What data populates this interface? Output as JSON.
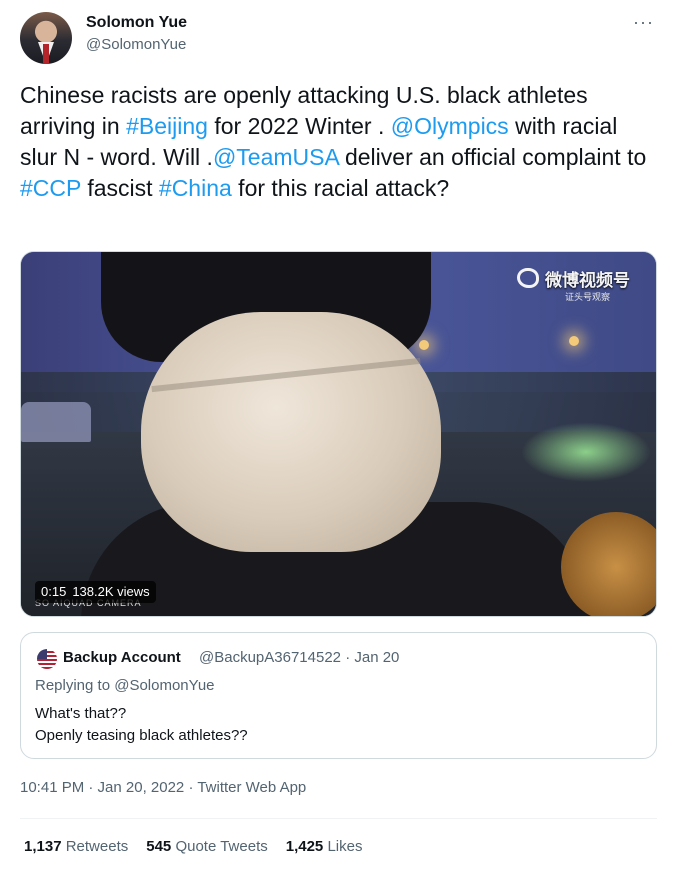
{
  "author": {
    "name": "Solomon Yue",
    "handle": "@SolomonYue"
  },
  "more_icon": "more-horizontal-icon",
  "tweet": {
    "segments": [
      {
        "text": "Chinese racists are openly attacking U.S. black athletes arriving in ",
        "link": false
      },
      {
        "text": "#Beijing",
        "link": true
      },
      {
        "text": " for 2022 Winter . ",
        "link": false
      },
      {
        "text": "@Olympics",
        "link": true
      },
      {
        "text": " with racial slur N - word. Will .",
        "link": false
      },
      {
        "text": "@TeamUSA",
        "link": true
      },
      {
        "text": " deliver an official complaint to ",
        "link": false
      },
      {
        "text": "#CCP",
        "link": true
      },
      {
        "text": " fascist ",
        "link": false
      },
      {
        "text": "#China",
        "link": true
      },
      {
        "text": " for this racial attack?",
        "link": false
      }
    ],
    "link_color": "#1d9bf0"
  },
  "video": {
    "duration": "0:15",
    "views": "138.2K views",
    "watermark": "微博视频号",
    "watermark_sub": "证头号观察",
    "caption_strip": "SO AIQUAD CAMERA"
  },
  "quote": {
    "name": "Backup Account",
    "handle": "@BackupA36714522",
    "separator": "·",
    "date": "Jan 20",
    "replying": "Replying to @SolomonYue",
    "lines": [
      "What's that??",
      "Openly teasing black athletes??"
    ]
  },
  "timestamp": "10:41 PM · Jan 20, 2022 · Twitter Web App",
  "stats": {
    "retweets_count": "1,137",
    "retweets_label": "Retweets",
    "quotes_count": "545",
    "quotes_label": "Quote Tweets",
    "likes_count": "1,425",
    "likes_label": "Likes"
  }
}
